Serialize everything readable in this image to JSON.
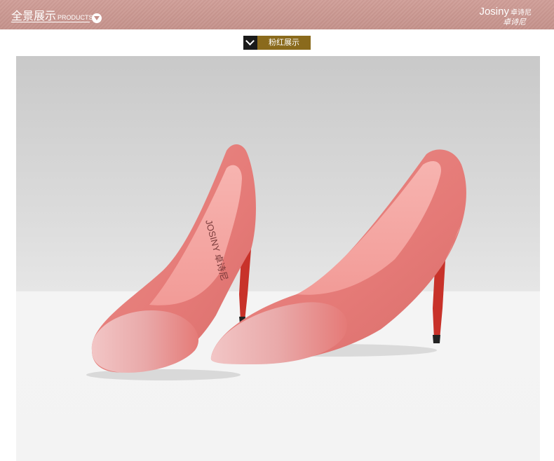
{
  "header": {
    "section_title_cn": "全景展示",
    "section_title_en": "PRODUCTS",
    "toggle_icon": "chevron-down-circle-icon",
    "brand_name": "Josiny",
    "brand_name_cn": "卓诗尼",
    "brand_signature": "卓诗尼"
  },
  "color_label": {
    "icon": "chevron-down-icon",
    "text": "粉红展示"
  },
  "photo": {
    "subject": "pink-pumps-photo",
    "insole_logo": "JOSINY 卓诗尼"
  },
  "colors": {
    "header_bg": "#c4918a",
    "label_dark": "#1a1a1a",
    "label_gold": "#8a6a1c",
    "shoe_pink": "#e7847f",
    "sole_red": "#c8322a"
  }
}
